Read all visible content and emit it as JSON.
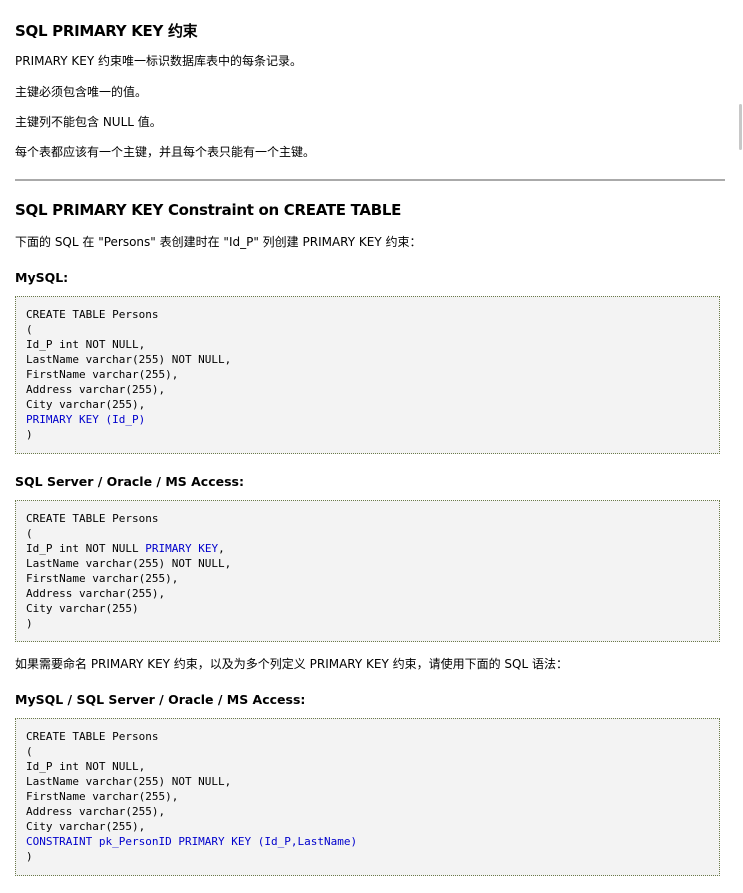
{
  "section1": {
    "title": "SQL PRIMARY KEY 约束",
    "paragraphs": [
      "PRIMARY KEY 约束唯一标识数据库表中的每条记录。",
      "主键必须包含唯一的值。",
      "主键列不能包含 NULL 值。",
      "每个表都应该有一个主键，并且每个表只能有一个主键。"
    ]
  },
  "section2": {
    "title": "SQL PRIMARY KEY Constraint on CREATE TABLE",
    "intro": "下面的 SQL 在 \"Persons\" 表创建时在 \"Id_P\" 列创建 PRIMARY KEY 约束：",
    "mysql_label": "MySQL:",
    "mysql_code": [
      [
        {
          "t": "CREATE TABLE Persons"
        }
      ],
      [
        {
          "t": "("
        }
      ],
      [
        {
          "t": "Id_P int NOT NULL,"
        }
      ],
      [
        {
          "t": "LastName varchar(255) NOT NULL,"
        }
      ],
      [
        {
          "t": "FirstName varchar(255),"
        }
      ],
      [
        {
          "t": "Address varchar(255),"
        }
      ],
      [
        {
          "t": "City varchar(255),"
        }
      ],
      [
        {
          "t": "PRIMARY KEY (Id_P)",
          "hl": true
        }
      ],
      [
        {
          "t": ")"
        }
      ]
    ],
    "sqlserver_label": "SQL Server / Oracle / MS Access:",
    "sqlserver_code": [
      [
        {
          "t": "CREATE TABLE Persons"
        }
      ],
      [
        {
          "t": "("
        }
      ],
      [
        {
          "t": "Id_P int NOT NULL "
        },
        {
          "t": "PRIMARY KEY",
          "hl": true
        },
        {
          "t": ","
        }
      ],
      [
        {
          "t": "LastName varchar(255) NOT NULL,"
        }
      ],
      [
        {
          "t": "FirstName varchar(255),"
        }
      ],
      [
        {
          "t": "Address varchar(255),"
        }
      ],
      [
        {
          "t": "City varchar(255)"
        }
      ],
      [
        {
          "t": ")"
        }
      ]
    ],
    "named_intro": "如果需要命名 PRIMARY KEY 约束，以及为多个列定义 PRIMARY KEY 约束，请使用下面的 SQL 语法：",
    "all_label": "MySQL / SQL Server / Oracle / MS Access:",
    "all_code": [
      [
        {
          "t": "CREATE TABLE Persons"
        }
      ],
      [
        {
          "t": "("
        }
      ],
      [
        {
          "t": "Id_P int NOT NULL,"
        }
      ],
      [
        {
          "t": "LastName varchar(255) NOT NULL,"
        }
      ],
      [
        {
          "t": "FirstName varchar(255),"
        }
      ],
      [
        {
          "t": "Address varchar(255),"
        }
      ],
      [
        {
          "t": "City varchar(255),"
        }
      ],
      [
        {
          "t": "CONSTRAINT pk_PersonID PRIMARY KEY (Id_P,LastName)",
          "hl": true
        }
      ],
      [
        {
          "t": ")"
        }
      ]
    ]
  },
  "colors": {
    "keyword_highlight": "#0000cc",
    "code_background": "#f3f3f3",
    "rule": "#aaaaaa"
  }
}
